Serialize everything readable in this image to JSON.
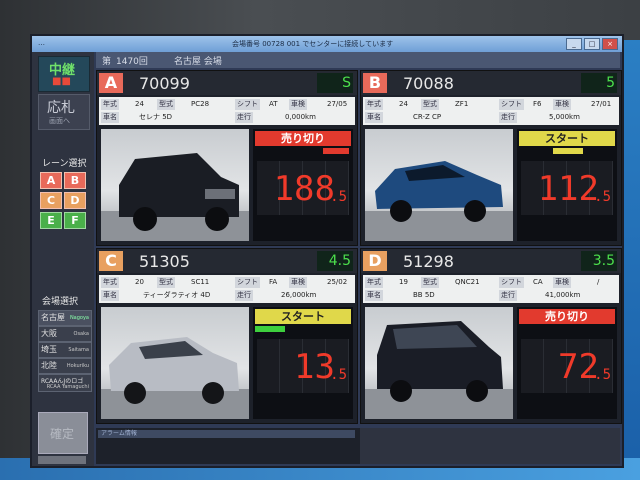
{
  "titlebar": {
    "left": "…",
    "center": "会場番号 00728 001 でセンターに接続しています"
  },
  "left_panel": {
    "chuken": "中継",
    "chuken_sub": "■■",
    "oufuda": "応札",
    "oufuda_sub": "画面へ",
    "lane_select_label": "レーン選択",
    "lane_buttons": [
      "A",
      "B",
      "C",
      "D",
      "E",
      "F"
    ],
    "venue_select_label": "会場選択",
    "venues": [
      {
        "name": "名古屋",
        "en": "Nagoya"
      },
      {
        "name": "大阪",
        "en": "Osaka"
      },
      {
        "name": "埼玉",
        "en": "Saitama"
      },
      {
        "name": "北陸",
        "en": "Hokuriku"
      },
      {
        "name": "RCAAんJのロゴ",
        "en": "RCAA Yamaguchi"
      }
    ],
    "gray_button": "確定"
  },
  "header": {
    "no_label": "第",
    "no_value": "1470回",
    "venue": "名古屋 会場"
  },
  "lanes": [
    {
      "letter": "A",
      "number": "70099",
      "score": "S",
      "year": "24",
      "model": "PC28",
      "shift": "AT",
      "inspection": "27/05",
      "name": "セレナ 5D",
      "mileage": "0,000km",
      "status": "売り切り",
      "price_int": "188",
      "price_dec": ".5"
    },
    {
      "letter": "B",
      "number": "70088",
      "score": "5",
      "year": "24",
      "model": "ZF1",
      "shift": "F6",
      "inspection": "27/01",
      "name": "CR-Z CP",
      "mileage": "5,000km",
      "status": "スタート",
      "price_int": "112",
      "price_dec": ".5"
    },
    {
      "letter": "C",
      "number": "51305",
      "score": "4.5",
      "year": "20",
      "model": "SC11",
      "shift": "FA",
      "inspection": "25/02",
      "name": "ティーダラティオ 4D",
      "mileage": "26,000km",
      "status": "スタート",
      "price_int": "13",
      "price_dec": ".5"
    },
    {
      "letter": "D",
      "number": "51298",
      "score": "3.5",
      "year": "19",
      "model": "QNC21",
      "shift": "CA",
      "inspection": "/",
      "name": "BB 5D",
      "mileage": "41,000km",
      "status": "売り切り",
      "price_int": "72",
      "price_dec": ".5"
    }
  ],
  "field_labels": {
    "year": "年式",
    "model": "型式",
    "shift": "シフト",
    "inspection": "車検",
    "name": "車名",
    "mileage": "走行"
  },
  "memo_label": "アラーム情報",
  "colors": {
    "sold": "#e23a2e",
    "start": "#e0d84a",
    "price": "#f03a2a",
    "score": "#4ce04c"
  }
}
